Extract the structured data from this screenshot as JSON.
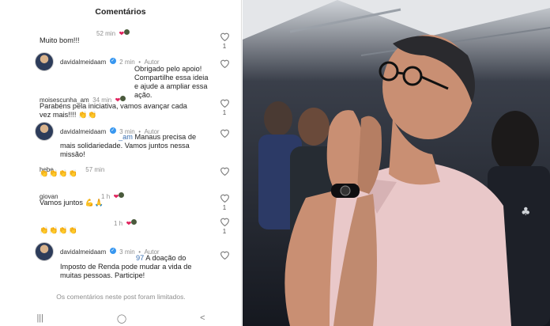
{
  "header": {
    "title": "Comentários"
  },
  "comments": [
    {
      "time": "52 min",
      "text": "Muito bom!!!",
      "likes": "1"
    },
    {
      "user": "davidalmeidaam",
      "time": "2 min",
      "author_label": "Autor",
      "text": "Obrigado pelo apoio! Compartilhe essa ideia e ajude a ampliar essa ação.",
      "likes": ""
    },
    {
      "user": "moisescunha_am",
      "time": "34 min",
      "text": "Parabéns pela iniciativa, vamos avançar cada vez mais!!!!",
      "emoji": "👏👏",
      "likes": "1"
    },
    {
      "user": "davidalmeidaam",
      "time": "3 min",
      "author_label": "Autor",
      "text_mention": "_am",
      "text": "Manaus precisa de mais solidariedade. Vamos juntos nessa missão!",
      "likes": ""
    },
    {
      "user": "hebe",
      "time": "57 min",
      "emoji": "👏👏👏👏",
      "likes": ""
    },
    {
      "user": "giovan",
      "time": "1 h",
      "text": "Vamos juntos",
      "emoji": "💪🙏",
      "likes": "1"
    },
    {
      "time": "1 h",
      "emoji": "👏👏👏👏",
      "likes": "1"
    },
    {
      "user": "davidalmeidaam",
      "time": "3 min",
      "author_label": "Autor",
      "text_mention": "97",
      "text": "A doação do Imposto de Renda pode mudar a vida de muitas pessoas. Participe!",
      "likes": ""
    }
  ],
  "footer": {
    "limited_text": "Os comentários neste post foram limitados."
  },
  "nav": {
    "recent": "|||",
    "home": "◯",
    "back": "<"
  },
  "colors": {
    "heart": "#e0245e",
    "verified": "#3897f0",
    "muted": "#8e8e8e"
  },
  "icons": [
    "heart-outline-icon",
    "verified-icon",
    "recent-apps-icon",
    "home-icon",
    "back-icon"
  ]
}
